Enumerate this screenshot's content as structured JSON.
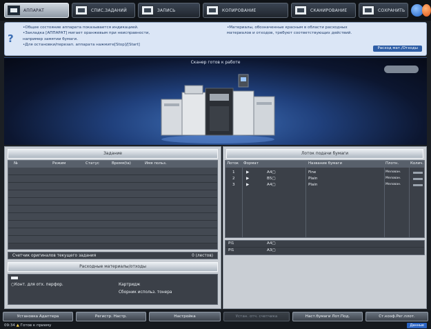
{
  "tabs": [
    {
      "label": "АППАРАТ",
      "active": true
    },
    {
      "label": "СПИС.ЗАДАНИЙ",
      "active": false
    },
    {
      "label": "ЗАПИСЬ",
      "active": false
    },
    {
      "label": "КОПИРОВАНИЕ",
      "active": false
    },
    {
      "label": "СКАНИРОВАНИЕ",
      "active": false
    },
    {
      "label": "СОХРАНИТЬ",
      "active": false
    }
  ],
  "banner": {
    "left_lines": [
      "•Общее состояние аппарата показывается индикацией.",
      "•Закладка [АППАРАТ] мигает оранжевым при неисправности,",
      "  например замятии бумаги.",
      "•Для остановки/перезап. аппарата нажмите[Stop]/[Start]"
    ],
    "right_lines": [
      "•Материалы, обозначенные красным в области расходных",
      "  материалов и отходов, требуют соответствующих действий."
    ],
    "consumables_button": "Расход мат./Отходы"
  },
  "machine": {
    "status": "Сканер готов к работе"
  },
  "jobs_panel": {
    "title": "Задание",
    "columns": [
      "№",
      "Режим",
      "Статус",
      "Время(ta)",
      "Имя польз."
    ],
    "counter_label": "Счетчик оригиналов текущего задания",
    "counter_value": "0 (лестов)"
  },
  "consumables_panel": {
    "title": "Расходные материалы/отходы",
    "item_left": "○Конт. для отх. перфор.",
    "item_right_1": "Картридж",
    "item_right_2": "Сборник использ. тонера"
  },
  "trays_panel": {
    "title": "Лоток подачи бумаги",
    "columns": [
      "Лоток",
      "Формат",
      "Название бумаги",
      "Плотн.",
      "Колич."
    ],
    "rows": [
      {
        "tray": "1",
        "size": "A4▢",
        "name": "Fine",
        "weight": "Мелован."
      },
      {
        "tray": "2",
        "size": "B5▢",
        "name": "Plain",
        "weight": "Мелован."
      },
      {
        "tray": "3",
        "size": "A4▢",
        "name": "Plain",
        "weight": "Мелован."
      }
    ],
    "pi_rows": [
      {
        "tray": "PI1",
        "size": "A4▢"
      },
      {
        "tray": "PI1",
        "size": "A3▢"
      }
    ]
  },
  "bottom_buttons": [
    {
      "label": "Установка Адаптера",
      "enabled": true
    },
    {
      "label": "Регистр. Настр.",
      "enabled": true
    },
    {
      "label": "Настройка",
      "enabled": true
    },
    {
      "label": "Устан. отч. счетчика",
      "enabled": false
    },
    {
      "label": "Наст.бумаги Лот.Под.",
      "enabled": true
    },
    {
      "label": "Ст.коэф.Рег.плот.",
      "enabled": true
    }
  ],
  "status_bar": {
    "time": "09:34",
    "message": "Готов к приему",
    "badge": "Данные"
  }
}
